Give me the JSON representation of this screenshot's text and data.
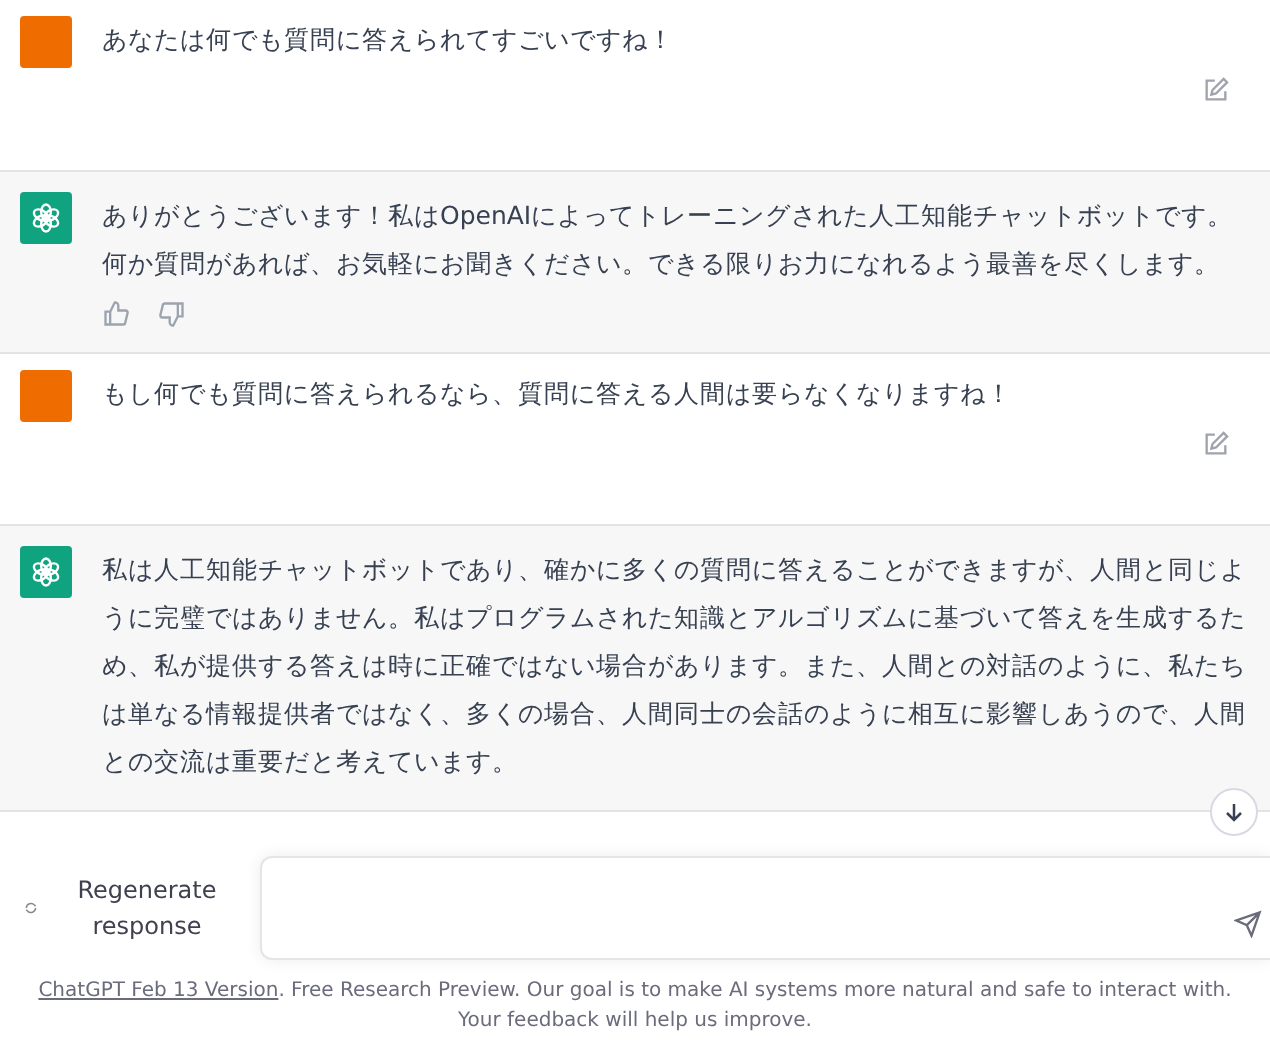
{
  "messages": [
    {
      "kind": "user",
      "text": "あなたは何でも質問に答えられてすごいですね！"
    },
    {
      "kind": "assistant",
      "text": "ありがとうございます！私はOpenAIによってトレーニングされた人工知能チャットボットです。何か質問があれば、お気軽にお聞きください。できる限りお力になれるよう最善を尽くします。",
      "feedback": true
    },
    {
      "kind": "user",
      "text": "もし何でも質問に答えられるなら、質問に答える人間は要らなくなりますね！"
    },
    {
      "kind": "assistant",
      "text": "私は人工知能チャットボットであり、確かに多くの質問に答えることができますが、人間と同じように完璧ではありません。私はプログラムされた知識とアルゴリズムに基づいて答えを生成するため、私が提供する答えは時に正確ではない場合があります。また、人間との対話のように、私たちは単なる情報提供者ではなく、多くの場合、人間同士の会話のように相互に影響しあうので、人間との交流は重要だと考えています。",
      "feedback": false
    }
  ],
  "regenerate_button": "Regenerate response",
  "footer": {
    "link": "ChatGPT Feb 13 Version",
    "text": ". Free Research Preview. Our goal is to make AI systems more natural and safe to interact with. Your feedback will help us improve."
  }
}
